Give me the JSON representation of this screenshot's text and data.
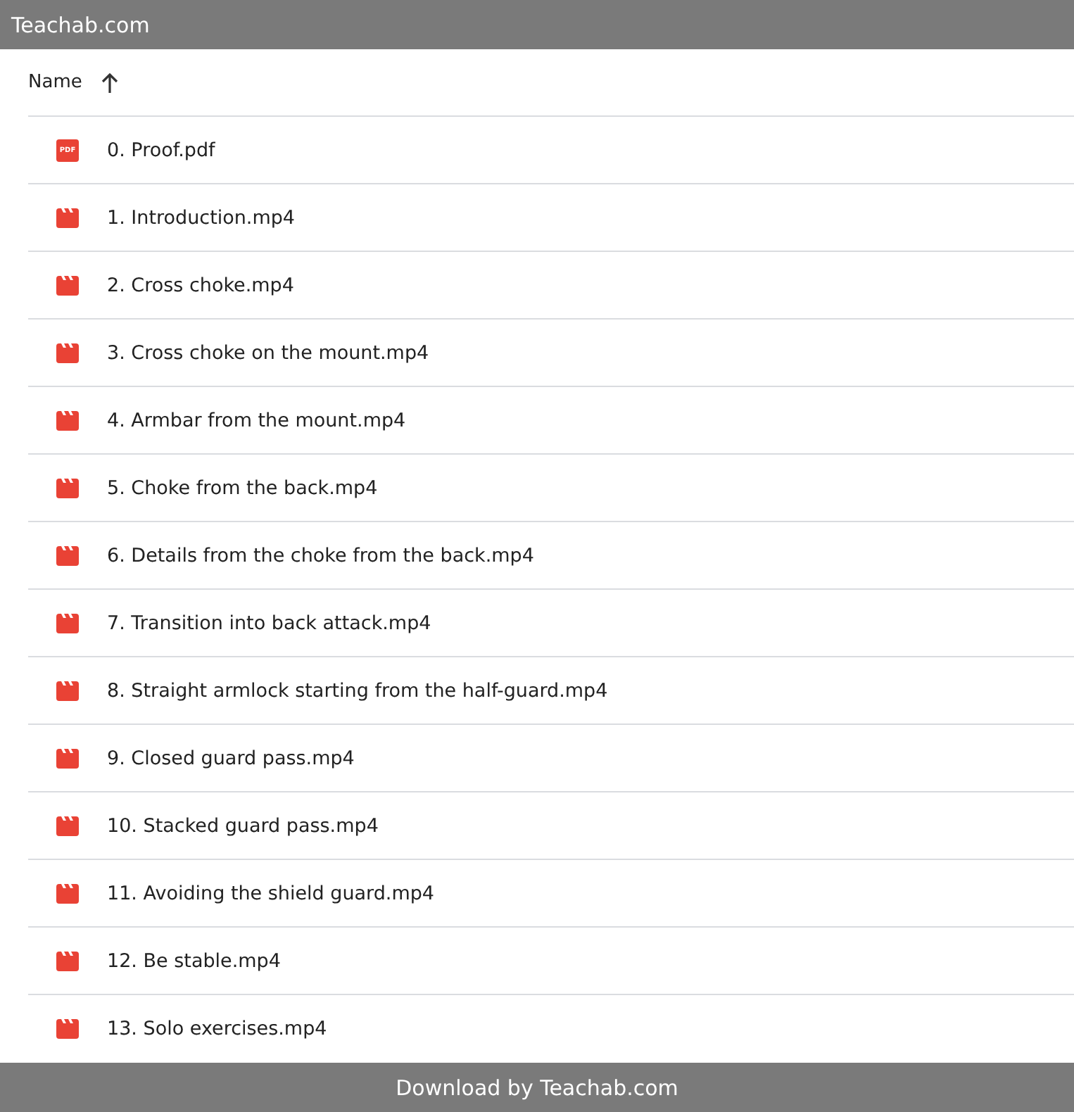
{
  "header": {
    "title": "Teachab.com"
  },
  "table": {
    "columns": [
      {
        "label": "Name",
        "sort_ascending": true
      }
    ],
    "rows": [
      {
        "kind": "pdf",
        "name": "0. Proof.pdf",
        "badge": "PDF"
      },
      {
        "kind": "video",
        "name": "1. Introduction.mp4"
      },
      {
        "kind": "video",
        "name": "2. Cross choke.mp4"
      },
      {
        "kind": "video",
        "name": "3. Cross choke on the mount.mp4"
      },
      {
        "kind": "video",
        "name": "4. Armbar from the mount.mp4"
      },
      {
        "kind": "video",
        "name": "5. Choke from the back.mp4"
      },
      {
        "kind": "video",
        "name": "6. Details from the choke from the back.mp4"
      },
      {
        "kind": "video",
        "name": "7. Transition into back attack.mp4"
      },
      {
        "kind": "video",
        "name": "8. Straight armlock starting from the half-guard.mp4"
      },
      {
        "kind": "video",
        "name": "9. Closed guard pass.mp4"
      },
      {
        "kind": "video",
        "name": "10. Stacked guard pass.mp4"
      },
      {
        "kind": "video",
        "name": "11. Avoiding the shield guard.mp4"
      },
      {
        "kind": "video",
        "name": "12. Be stable.mp4"
      },
      {
        "kind": "video",
        "name": "13. Solo exercises.mp4"
      }
    ]
  },
  "footer": {
    "text": "Download by Teachab.com"
  }
}
